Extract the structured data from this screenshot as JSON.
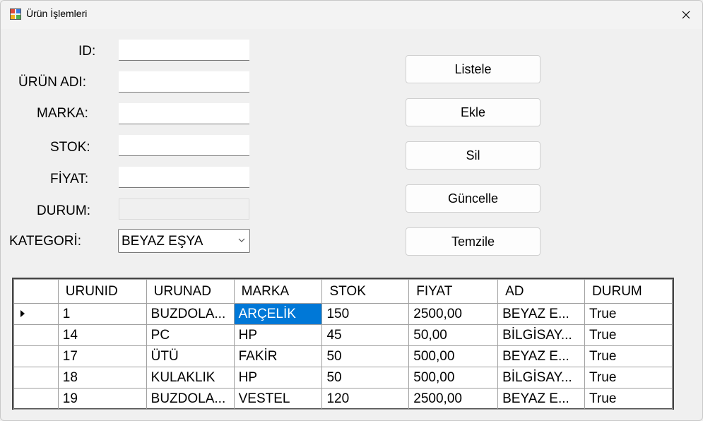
{
  "window": {
    "title": "Ürün İşlemleri"
  },
  "form": {
    "id_label": "ID:",
    "urun_adi_label": "ÜRÜN ADI:",
    "marka_label": "MARKA:",
    "stok_label": "STOK:",
    "fiyat_label": "FİYAT:",
    "durum_label": "DURUM:",
    "kategori_label": "KATEGORİ:",
    "id_value": "",
    "urun_adi_value": "",
    "marka_value": "",
    "stok_value": "",
    "fiyat_value": "",
    "durum_value": "",
    "kategori_selected": "BEYAZ EŞYA"
  },
  "buttons": {
    "listele": "Listele",
    "ekle": "Ekle",
    "sil": "Sil",
    "guncelle": "Güncelle",
    "temzile": "Temzile"
  },
  "grid": {
    "columns": [
      "URUNID",
      "URUNAD",
      "MARKA",
      "STOK",
      "FIYAT",
      "AD",
      "DURUM"
    ],
    "rows": [
      [
        "1",
        "BUZDOLA...",
        "ARÇELİK",
        "150",
        "2500,00",
        "BEYAZ E...",
        "True"
      ],
      [
        "14",
        "PC",
        "HP",
        "45",
        "50,00",
        "BİLGİSAY...",
        "True"
      ],
      [
        "17",
        "ÜTÜ",
        "FAKİR",
        "50",
        "500,00",
        "BEYAZ E...",
        "True"
      ],
      [
        "18",
        "KULAKLIK",
        "HP",
        "50",
        "500,00",
        "BİLGİSAY...",
        "True"
      ],
      [
        "19",
        "BUZDOLA...",
        "VESTEL",
        "120",
        "2500,00",
        "BEYAZ E...",
        "True"
      ]
    ],
    "current_row": 0,
    "selected_column": 2
  },
  "colors": {
    "selection": "#0078d7",
    "window_bg": "#f0f0f0"
  }
}
